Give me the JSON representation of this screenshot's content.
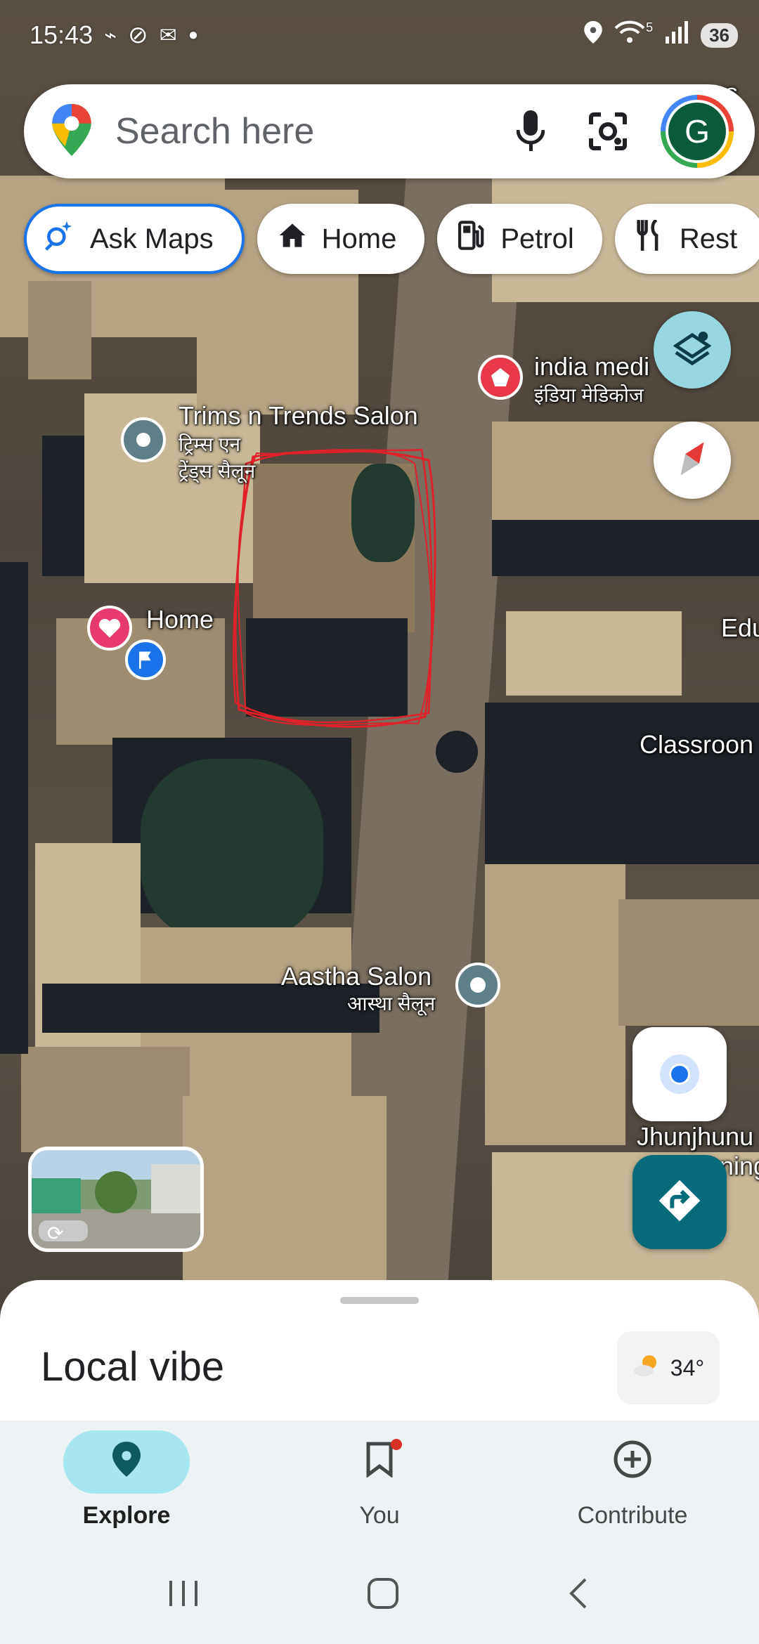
{
  "status_bar": {
    "time": "15:43",
    "wifi_badge": "5",
    "battery": "36"
  },
  "search": {
    "placeholder": "Search here",
    "avatar_letter": "G"
  },
  "chips": [
    {
      "label": "Ask Maps",
      "icon": "sparkle-search-icon"
    },
    {
      "label": "Home",
      "icon": "home-icon"
    },
    {
      "label": "Petrol",
      "icon": "fuel-icon"
    },
    {
      "label": "Rest",
      "icon": "restaurant-icon"
    }
  ],
  "map": {
    "labels": {
      "trims_en": "Trims n Trends Salon",
      "trims_hi_1": "ट्रिम्स एन",
      "trims_hi_2": "ट्रेंड्स सैलून",
      "india_en": "india medi",
      "india_hi": "इंडिया मेडिकोज",
      "home": "Home",
      "edu": "Edu",
      "classroom": "Classroon",
      "aastha_en": "Aastha Salon",
      "aastha_hi": "आस्था सैलून",
      "jhunjhunu": "Jhunjhunu",
      "jhunjhunu_2": "ning",
      "top_right_1": "ers"
    },
    "annotation_color": "#e0202a"
  },
  "sheet": {
    "title": "Local vibe",
    "weather_temp": "34°"
  },
  "nav": {
    "items": [
      {
        "label": "Explore",
        "icon": "explore-pin-icon",
        "active": true
      },
      {
        "label": "You",
        "icon": "bookmark-icon",
        "badge": true
      },
      {
        "label": "Contribute",
        "icon": "add-circle-icon"
      }
    ]
  },
  "colors": {
    "accent": "#1a73e8",
    "teal": "#086b7a",
    "explore_pill": "#a8e6ef"
  }
}
